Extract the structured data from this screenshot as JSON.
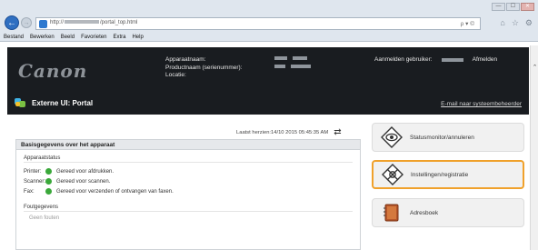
{
  "browser": {
    "address": {
      "prefix": "http://",
      "suffix": "/portal_top.html"
    },
    "search_glyph": "ρ ▾ ©",
    "window_buttons": [
      "—",
      "☐",
      "✕"
    ],
    "menu": [
      "Bestand",
      "Bewerken",
      "Beeld",
      "Favorieten",
      "Extra",
      "Help"
    ]
  },
  "header": {
    "logo_text": "Canon",
    "device_name_label": "Apparaatnaam:",
    "product_name_label": "Productnaam (serienummer):",
    "location_label": "Locatie:",
    "login_label": "Aanmelden gebruiker:",
    "logout_label": "Afmelden",
    "portal_title": "Externe UI: Portal",
    "mail_admin": "E-mail naar systeembeheerder"
  },
  "main": {
    "last_updated": "Laatst herzien:14/10 2015 05:45:35 AM",
    "panel_title": "Basisgegevens over het apparaat",
    "device_status_title": "Apparaatstatus",
    "statuses": [
      {
        "label": "Printer:",
        "text": "Gereed voor afdrukken."
      },
      {
        "label": "Scanner:",
        "text": "Gereed voor scannen."
      },
      {
        "label": "Fax:",
        "text": "Gereed voor verzenden of ontvangen van faxen."
      }
    ],
    "error_title": "Foutgegevens",
    "error_text": "Geen fouten"
  },
  "side_buttons": [
    {
      "label": "Statusmonitor/annuleren",
      "icon": "status-monitor-icon"
    },
    {
      "label": "Instellingen/registratie",
      "icon": "settings-registration-icon"
    },
    {
      "label": "Adresboek",
      "icon": "address-book-icon"
    }
  ],
  "colors": {
    "accent_highlight": "#f0a12b",
    "status_ok": "#3aa83a",
    "header_bg": "#191c20"
  }
}
